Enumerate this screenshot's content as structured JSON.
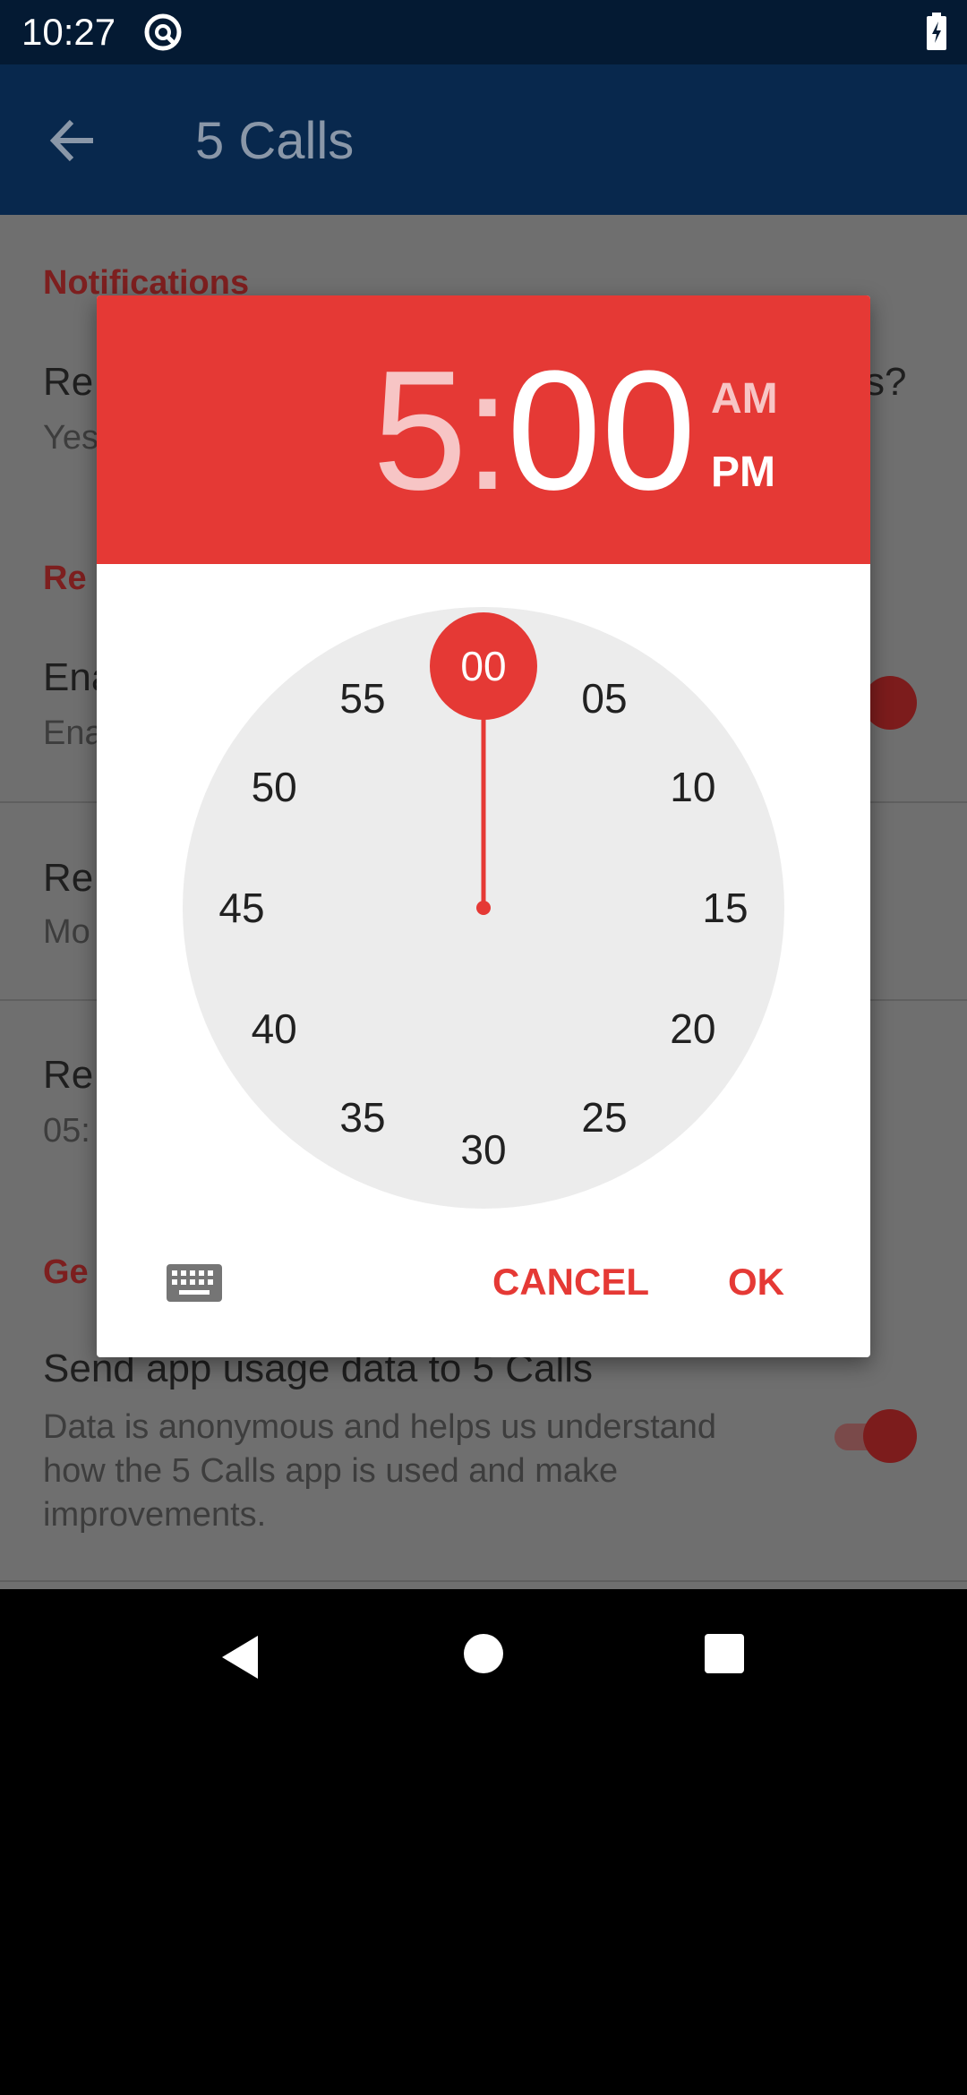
{
  "status_bar": {
    "time": "10:27"
  },
  "app_bar": {
    "title": "5 Calls"
  },
  "settings": {
    "sections": [
      {
        "header": "Notifications"
      },
      {
        "header": "Re"
      },
      {
        "header": "Ge"
      }
    ],
    "items": [
      {
        "title": "Re",
        "title_tail": "s?",
        "subtitle": "Yes"
      },
      {
        "title": "Ena",
        "subtitle": "Ena"
      },
      {
        "title": "Re",
        "subtitle": "Mo"
      },
      {
        "title": "Re",
        "subtitle": "05:"
      },
      {
        "title": "Send app usage data to 5 Calls",
        "subtitle": "Data is anonymous and helps us understand how the 5 Calls app is used and make improvements."
      }
    ]
  },
  "time_picker": {
    "hour": "5",
    "separator": ":",
    "minute": "00",
    "am_label": "AM",
    "pm_label": "PM",
    "selected_period": "PM",
    "selected_minute": "00",
    "minutes": [
      "00",
      "05",
      "10",
      "15",
      "20",
      "25",
      "30",
      "35",
      "40",
      "45",
      "50",
      "55"
    ],
    "cancel_label": "CANCEL",
    "ok_label": "OK"
  },
  "colors": {
    "accent": "#e53935",
    "app_bar": "#08284d",
    "status_bar": "#041a33",
    "clock_face": "#ececec"
  },
  "icons": {
    "back": "arrow-back-icon",
    "at": "at-sign-icon",
    "battery": "battery-charging-icon",
    "keyboard": "keyboard-icon",
    "nav_back": "triangle-back-icon",
    "nav_home": "circle-home-icon",
    "nav_recents": "square-recents-icon"
  }
}
